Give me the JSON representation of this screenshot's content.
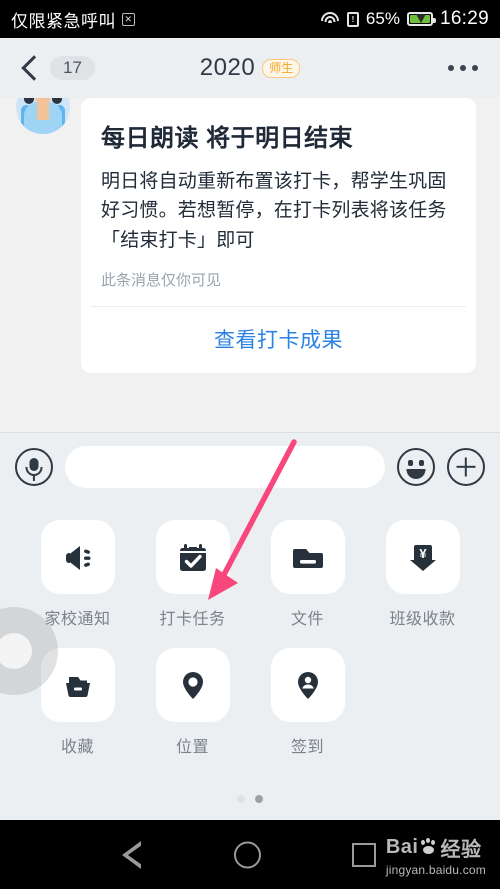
{
  "status_bar": {
    "carrier": "仅限紧急呼叫",
    "carrier_glyph_name": "no-service-icon",
    "wifi_icon": "wifi-icon",
    "sim_icon": "sim-card-alert-icon",
    "battery_percent": "65%",
    "battery_icon": "battery-charging-icon",
    "time": "16:29"
  },
  "navbar": {
    "back_icon": "back-chevron-icon",
    "unread_count": "17",
    "title": "2020",
    "title_tag": "师生",
    "tag_color": "#f5a623",
    "more_icon": "more-options-icon"
  },
  "chat": {
    "avatar_name": "sender-avatar",
    "card": {
      "title": "每日朗读 将于明日结束",
      "body": "明日将自动重新布置该打卡，帮学生巩固好习惯。若想暂停，在打卡列表将该任务「结束打卡」即可",
      "note": "此条消息仅你可见",
      "action_label": "查看打卡成果",
      "action_color": "#2a82e4"
    }
  },
  "input_bar": {
    "voice_icon": "microphone-icon",
    "input_value": "",
    "input_placeholder": "",
    "emoji_icon": "emoji-smiley-icon",
    "more_icon": "plus-icon"
  },
  "app_panel": {
    "rows": [
      [
        {
          "label": "家校通知",
          "icon": "megaphone-icon"
        },
        {
          "label": "打卡任务",
          "icon": "calendar-check-icon"
        },
        {
          "label": "文件",
          "icon": "folder-icon"
        },
        {
          "label": "班级收款",
          "icon": "yuan-download-icon"
        }
      ],
      [
        {
          "label": "收藏",
          "icon": "favorites-folder-icon"
        },
        {
          "label": "位置",
          "icon": "location-pin-icon"
        },
        {
          "label": "签到",
          "icon": "check-in-pin-icon"
        }
      ]
    ],
    "page_dots": {
      "count": 2,
      "active_index": 1
    }
  },
  "annotation": {
    "arrow_color": "#f8477d",
    "arrow_target": "打卡任务",
    "name": "pink-pointer-arrow"
  },
  "touch_indicator": {
    "name": "touch-point-indicator"
  },
  "android_nav": {
    "back_icon": "android-back-icon",
    "home_icon": "android-home-icon",
    "recents_icon": "android-recents-icon"
  },
  "watermark": {
    "brand": "Bai",
    "brand_suffix": "du",
    "label": "经验",
    "url": "jingyan.baidu.com"
  }
}
